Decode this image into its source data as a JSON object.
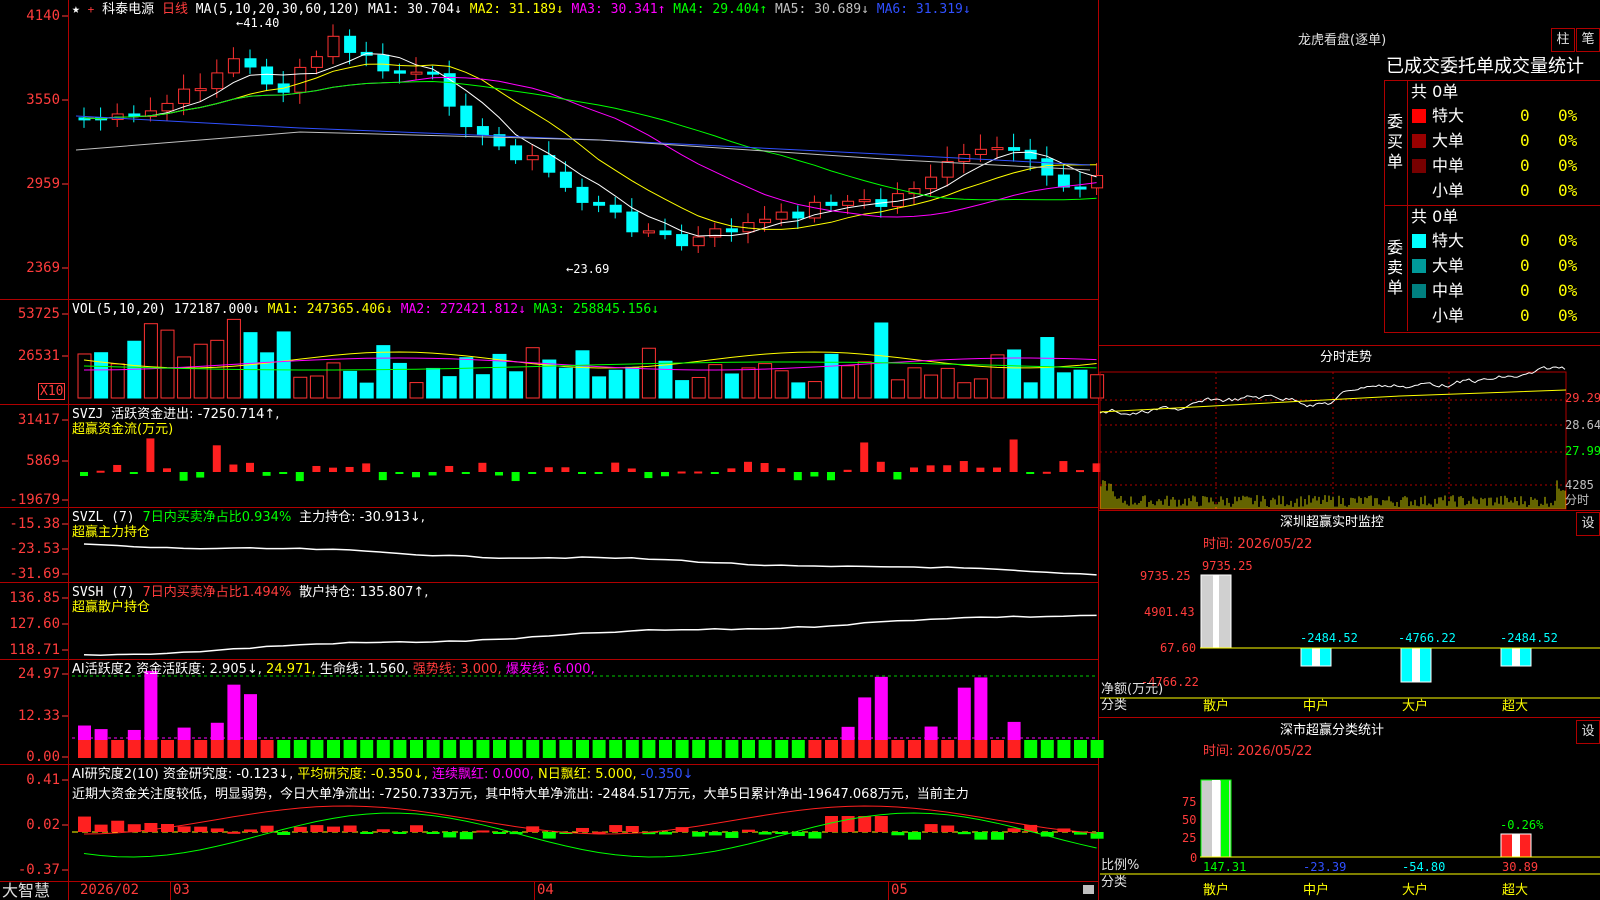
{
  "app": {
    "brand": "大智慧",
    "lock_icon": "lock-icon"
  },
  "stock": {
    "name": "科泰电源",
    "period": "日线"
  },
  "kline": {
    "ma_label": "MA(5,10,20,30,60,120)",
    "ma1": "MA1: 30.704↓",
    "ma2": "MA2: 31.189↓",
    "ma3": "MA3: 30.341↑",
    "ma4": "MA4: 29.404↑",
    "ma5": "MA5: 30.689↓",
    "ma6": "MA6: 31.319↓",
    "high_mark": "←41.40",
    "low_mark": "←23.69",
    "axis": [
      "4140",
      "3550",
      "2959",
      "2369"
    ]
  },
  "vol": {
    "label": "VOL(5,10,20)",
    "v": "172187.000↓",
    "ma1": "MA1: 247365.406↓",
    "ma2": "MA2: 272421.812↓",
    "ma3": "MA3: 258845.156↓",
    "axis": [
      "53725",
      "26531"
    ],
    "unit": "X10"
  },
  "svzj": {
    "label": "SVZJ",
    "line1": "活跃资金进出: -7250.714↑,",
    "line2": "超赢资金流(万元)",
    "axis": [
      "31417",
      "5869",
      "-19679"
    ]
  },
  "svzl": {
    "label": "SVZL (7)",
    "p1": "7日内买卖净占比0.934%",
    "p2": "主力持仓: -30.913↓,",
    "line2": "超赢主力持仓",
    "axis": [
      "-15.38",
      "-23.53",
      "-31.69"
    ]
  },
  "svsh": {
    "label": "SVSH (7)",
    "p1": "7日内买卖净占比1.494%",
    "p2": "散户持仓: 135.807↑,",
    "line2": "超赢散户持仓",
    "axis": [
      "136.85",
      "127.60",
      "118.71"
    ]
  },
  "ai1": {
    "label": "AI活跃度2",
    "p1": "资金活跃度: 2.905↓,",
    "p2": "24.971,",
    "p3": "生命线: 1.560,",
    "p4": "强势线: 3.000,",
    "p5": "爆发线: 6.000,",
    "axis": [
      "24.97",
      "12.33",
      "0.00"
    ]
  },
  "ai2": {
    "label": "AI研究度2(10)",
    "p1": "资金研究度: -0.123↓,",
    "p2": "平均研究度: -0.350↓,",
    "p3": "连续飘红: 0.000,",
    "p4": "N日飘红: 5.000,",
    "p5": "-0.350↓",
    "summary": "近期大资金关注度较低，明显弱势，今日大单净流出: -7250.733万元，其中特大单净流出: -2484.517万元，大单5日累计净出-19647.068万元，当前主力",
    "axis": [
      "0.41",
      "0.02",
      "-0.37"
    ]
  },
  "dates": {
    "d1": "2026/02",
    "d2": "03",
    "d3": "04",
    "d4": "05"
  },
  "lhb": {
    "title": "龙虎看盘(逐单)",
    "btn_zhu": "柱",
    "btn_bi": "笔",
    "header": "已成交委托单成交量统计",
    "buy_label": "委买单",
    "sell_label": "委卖单",
    "buy_total": "共 0单",
    "sell_total": "共 0单",
    "rows": [
      {
        "name": "特大",
        "count": "0",
        "pct": "0%"
      },
      {
        "name": "大单",
        "count": "0",
        "pct": "0%"
      },
      {
        "name": "中单",
        "count": "0",
        "pct": "0%"
      },
      {
        "name": "小单",
        "count": "0",
        "pct": "0%"
      }
    ],
    "colors": {
      "buy": [
        "#ff0000",
        "#990000",
        "#770000"
      ],
      "sell": [
        "#00ffff",
        "#009999",
        "#008080"
      ]
    }
  },
  "intraday": {
    "title": "分时走势",
    "axis": [
      "29.29",
      "28.64",
      "27.99"
    ],
    "vol_axis": "4285",
    "unit": "分时"
  },
  "szmon": {
    "title": "深圳超赢实时监控",
    "btn": "设",
    "time": "时间: 2026/05/22",
    "top": "9735.25",
    "axis": [
      "9735.25",
      "4901.43",
      "67.60",
      "-4766.22"
    ],
    "netlabel": "净额(万元)",
    "cat_label": "分类",
    "values": [
      "-2484.52",
      "-4766.22",
      "-2484.52"
    ],
    "cats": [
      "散户",
      "中户",
      "大户",
      "超大"
    ]
  },
  "szcls": {
    "title": "深市超赢分类统计",
    "btn": "设",
    "time": "时间: 2026/05/22",
    "axis": [
      "75",
      "50",
      "25",
      "0"
    ],
    "pct_label": "比例%",
    "cat_label": "分类",
    "top_val": "-0.26%",
    "values": [
      "147.31",
      "-23.39",
      "-54.80",
      "30.89"
    ],
    "cats": [
      "散户",
      "中户",
      "大户",
      "超大"
    ]
  }
}
